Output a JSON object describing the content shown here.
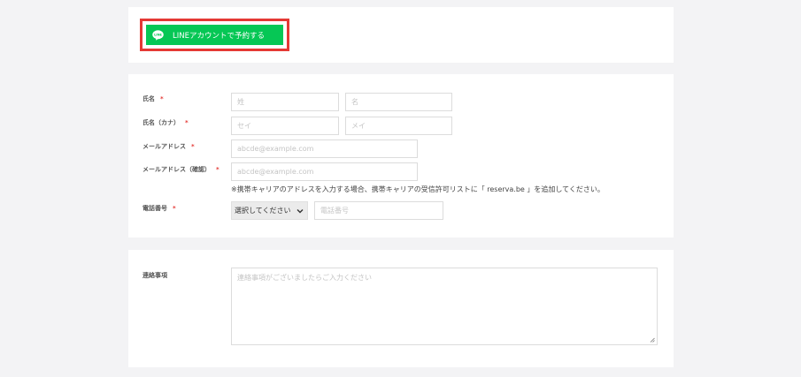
{
  "line_section": {
    "button_label": "LINEアカウントで予約する",
    "logo_text": "LINE"
  },
  "form": {
    "name": {
      "label": "氏名",
      "required_mark": "*",
      "last_placeholder": "姓",
      "first_placeholder": "名"
    },
    "name_kana": {
      "label": "氏名（カナ）",
      "required_mark": "*",
      "last_placeholder": "セイ",
      "first_placeholder": "メイ"
    },
    "email": {
      "label": "メールアドレス",
      "required_mark": "*",
      "placeholder": "abcde@example.com"
    },
    "email_confirm": {
      "label": "メールアドレス（確認）",
      "required_mark": "*",
      "placeholder": "abcde@example.com",
      "note": "※携帯キャリアのアドレスを入力する場合、携帯キャリアの受信許可リストに「 reserva.be 」を追加してください。"
    },
    "phone": {
      "label": "電話番号",
      "required_mark": "*",
      "select_value": "選択してください",
      "placeholder": "電話番号"
    }
  },
  "notes_section": {
    "label": "連絡事項",
    "placeholder": "連絡事項がございましたらご入力ください"
  },
  "colors": {
    "line_green": "#06c755",
    "highlight_red": "#e53935",
    "required_red": "#e53935",
    "page_bg": "#f3f3f5"
  }
}
